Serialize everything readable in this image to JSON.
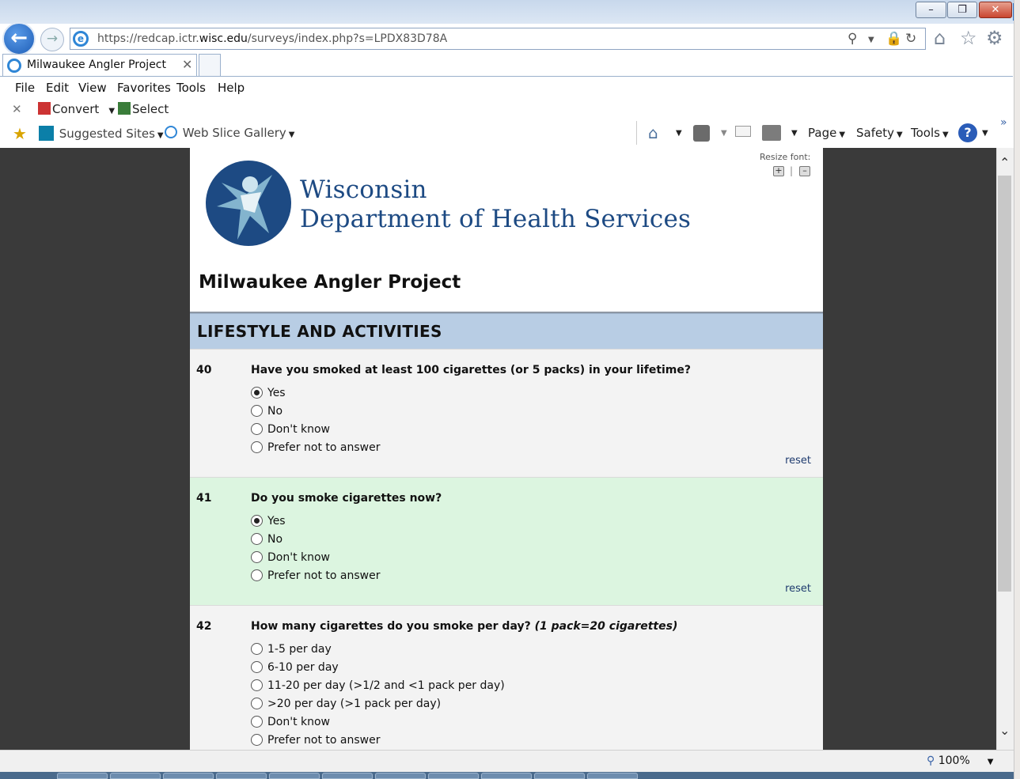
{
  "browser": {
    "url_prefix": "https://redcap.ictr.",
    "url_domain": "wisc.edu",
    "url_suffix": "/surveys/index.php?s=LPDX83D78A",
    "tab_title": "Milwaukee Angler Project",
    "menu": [
      "File",
      "Edit",
      "View",
      "Favorites",
      "Tools",
      "Help"
    ],
    "command_bar1": {
      "convert": "Convert",
      "select": "Select"
    },
    "favorites_bar": {
      "suggested_sites": "Suggested Sites",
      "web_slice_gallery": "Web Slice Gallery"
    },
    "command_bar2": {
      "page": "Page",
      "safety": "Safety",
      "tools": "Tools"
    },
    "zoom": "100%"
  },
  "header": {
    "resize_font_label": "Resize font:",
    "org_line1": "Wisconsin",
    "org_line2": "Department of  Health Services",
    "survey_title": "Milwaukee Angler Project"
  },
  "section": {
    "title": "LIFESTYLE AND ACTIVITIES"
  },
  "questions": [
    {
      "number": "40",
      "text": "Have you smoked at least 100 cigarettes (or 5 packs) in your lifetime?",
      "options": [
        "Yes",
        "No",
        "Don't know",
        "Prefer not to answer"
      ],
      "selected": "Yes",
      "reset": "reset"
    },
    {
      "number": "41",
      "text": "Do you smoke cigarettes now?",
      "options": [
        "Yes",
        "No",
        "Don't know",
        "Prefer not to answer"
      ],
      "selected": "Yes",
      "reset": "reset"
    },
    {
      "number": "42",
      "text": "How many cigarettes do you smoke per day?",
      "note": "(1 pack=20 cigarettes)",
      "options": [
        "1-5 per day",
        "6-10 per day",
        "11-20 per day (>1/2 and <1 pack per day)",
        ">20 per day (>1 pack per day)",
        "Don't know",
        "Prefer not to answer"
      ],
      "selected": ""
    }
  ],
  "colors": {
    "section_header_bg": "#b8cde4",
    "highlight_row_bg": "#dcf5e0",
    "row_bg": "#f3f3f3",
    "brand_blue": "#1d4a83"
  }
}
